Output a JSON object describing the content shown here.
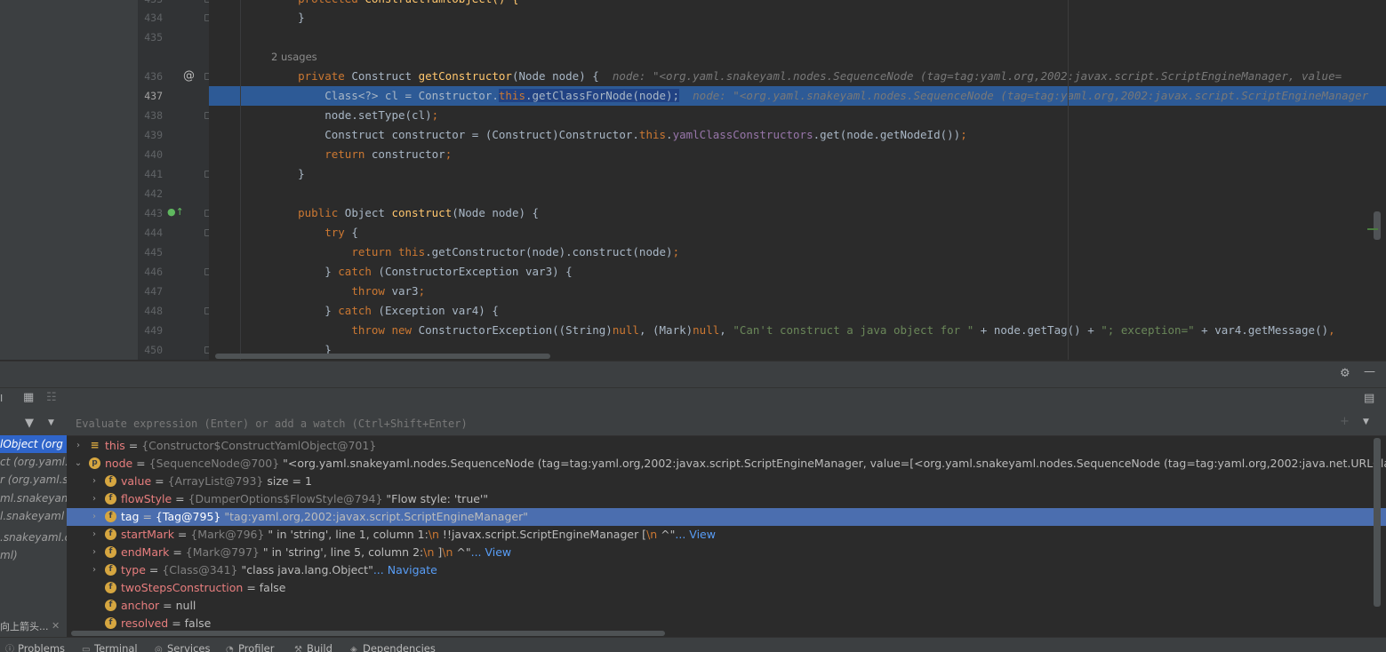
{
  "editor": {
    "usages_hint": "2 usages",
    "lines": [
      {
        "num": "433",
        "segments": [
          {
            "t": "    protected ",
            "c": "kw"
          },
          {
            "t": "ConstructYamlObject() {",
            "c": "fn"
          }
        ]
      },
      {
        "num": "434",
        "segments": [
          {
            "t": "    }"
          }
        ]
      },
      {
        "num": "435",
        "segments": []
      },
      {
        "num": "436",
        "segments": [
          {
            "t": "    private ",
            "c": "kw"
          },
          {
            "t": "Construct "
          },
          {
            "t": "getConstructor",
            "c": "fn"
          },
          {
            "t": "(Node node) {  "
          },
          {
            "t": "node: \"<org.yaml.snakeyaml.nodes.SequenceNode (tag=tag:yaml.org,2002:javax.script.ScriptEngineManager, value=",
            "c": "hint"
          }
        ]
      },
      {
        "num": "437",
        "segments": [
          {
            "t": "        Class<?> cl = Constructor."
          },
          {
            "t": "this",
            "c": "kw sel"
          },
          {
            "t": ".getClassForNode(node);",
            "c": "sel"
          },
          {
            "t": "  "
          },
          {
            "t": "node: \"<org.yaml.snakeyaml.nodes.SequenceNode (tag=tag:yaml.org,2002:javax.script.ScriptEngineManager",
            "c": "hint"
          }
        ]
      },
      {
        "num": "438",
        "segments": [
          {
            "t": "        node.setType(cl)"
          },
          {
            "t": ";",
            "c": "kw"
          }
        ]
      },
      {
        "num": "439",
        "segments": [
          {
            "t": "        Construct constructor = (Construct)Constructor."
          },
          {
            "t": "this",
            "c": "kw"
          },
          {
            "t": "."
          },
          {
            "t": "yamlClassConstructors",
            "c": "fld"
          },
          {
            "t": ".get(node.getNodeId())"
          },
          {
            "t": ";",
            "c": "kw"
          }
        ]
      },
      {
        "num": "440",
        "segments": [
          {
            "t": "        "
          },
          {
            "t": "return ",
            "c": "kw"
          },
          {
            "t": "constructor"
          },
          {
            "t": ";",
            "c": "kw"
          }
        ]
      },
      {
        "num": "441",
        "segments": [
          {
            "t": "    }"
          }
        ]
      },
      {
        "num": "442",
        "segments": []
      },
      {
        "num": "443",
        "segments": [
          {
            "t": "    public ",
            "c": "kw"
          },
          {
            "t": "Object "
          },
          {
            "t": "construct",
            "c": "fn"
          },
          {
            "t": "(Node node) {"
          }
        ]
      },
      {
        "num": "444",
        "segments": [
          {
            "t": "        "
          },
          {
            "t": "try ",
            "c": "kw"
          },
          {
            "t": "{"
          }
        ]
      },
      {
        "num": "445",
        "segments": [
          {
            "t": "            "
          },
          {
            "t": "return this",
            "c": "kw"
          },
          {
            "t": ".getConstructor(node).construct(node)"
          },
          {
            "t": ";",
            "c": "kw"
          }
        ]
      },
      {
        "num": "446",
        "segments": [
          {
            "t": "        } "
          },
          {
            "t": "catch ",
            "c": "kw"
          },
          {
            "t": "(ConstructorException var3) {"
          }
        ]
      },
      {
        "num": "447",
        "segments": [
          {
            "t": "            "
          },
          {
            "t": "throw ",
            "c": "kw"
          },
          {
            "t": "var3"
          },
          {
            "t": ";",
            "c": "kw"
          }
        ]
      },
      {
        "num": "448",
        "segments": [
          {
            "t": "        } "
          },
          {
            "t": "catch ",
            "c": "kw"
          },
          {
            "t": "(Exception var4) {"
          }
        ]
      },
      {
        "num": "449",
        "segments": [
          {
            "t": "            "
          },
          {
            "t": "throw new ",
            "c": "kw"
          },
          {
            "t": "ConstructorException((String)"
          },
          {
            "t": "null",
            "c": "kw"
          },
          {
            "t": ", (Mark)"
          },
          {
            "t": "null",
            "c": "kw"
          },
          {
            "t": ", "
          },
          {
            "t": "\"Can't construct a java object for \"",
            "c": "str"
          },
          {
            "t": " + node.getTag() + "
          },
          {
            "t": "\"; exception=\"",
            "c": "str"
          },
          {
            "t": " + var4.getMessage()"
          },
          {
            "t": ",",
            "c": "kw"
          }
        ]
      },
      {
        "num": "450",
        "segments": [
          {
            "t": "        }"
          }
        ]
      }
    ]
  },
  "debugger": {
    "watch_placeholder": "Evaluate expression (Enter) or add a watch (Ctrl+Shift+Enter)",
    "frames": [
      {
        "label": "lObject (org"
      },
      {
        "label": "ct (org.yaml."
      },
      {
        "label": "r (org.yaml.s"
      },
      {
        "label": "ml.snakeyaml."
      },
      {
        "label": "l.snakeyaml"
      },
      {
        "label": ".snakeyaml.c"
      },
      {
        "label": "ml)"
      }
    ],
    "frames_bottom_label": "向上箭头...",
    "variables": [
      {
        "name": "this",
        "badge": "list",
        "arrow": "›",
        "eq": " = ",
        "type": "{Constructor$ConstructYamlObject@701}",
        "rest": "",
        "link": ""
      },
      {
        "name": "node",
        "badge": "p",
        "arrow": "⌄",
        "eq": " = ",
        "type": "{SequenceNode@700} ",
        "rest": "\"<org.yaml.snakeyaml.nodes.SequenceNode (tag=tag:yaml.org,2002:javax.script.ScriptEngineManager, value=[<org.yaml.snakeyaml.nodes.SequenceNode (tag=tag:yaml.org,2002:java.net.URLClassLoader, valu",
        "link": "... View"
      },
      {
        "name": "value",
        "badge": "f",
        "arrow": "›",
        "eq": " = ",
        "type": "{ArrayList@793} ",
        "rest": " size = 1",
        "link": ""
      },
      {
        "name": "flowStyle",
        "badge": "f",
        "arrow": "›",
        "eq": " = ",
        "type": "{DumperOptions$FlowStyle@794} ",
        "rest": "\"Flow style: 'true'\"",
        "link": ""
      },
      {
        "name": "tag",
        "badge": "f",
        "arrow": "›",
        "eq": " = ",
        "type": "{Tag@795} ",
        "rest": "\"tag:yaml.org,2002:javax.script.ScriptEngineManager\"",
        "link": ""
      },
      {
        "name": "startMark",
        "badge": "f",
        "arrow": "›",
        "eq": " = ",
        "type": "{Mark@796} ",
        "rest": "\" in 'string', line 1, column 1:",
        "esc": "\\n",
        "rest2": "    !!javax.script.ScriptEngineManager [",
        "esc2": "\\n",
        "rest3": "    ^\"",
        "link": "... View"
      },
      {
        "name": "endMark",
        "badge": "f",
        "arrow": "›",
        "eq": " = ",
        "type": "{Mark@797} ",
        "rest": "\" in 'string', line 5, column 2:",
        "esc": "\\n",
        "rest2": "    ]",
        "esc2": "\\n",
        "rest3": "    ^\"",
        "link": "... View"
      },
      {
        "name": "type",
        "badge": "f",
        "arrow": "›",
        "eq": " = ",
        "type": "{Class@341} ",
        "rest": "\"class java.lang.Object\"",
        "link": "... Navigate"
      },
      {
        "name": "twoStepsConstruction",
        "badge": "f",
        "arrow": "",
        "eq": " = ",
        "type": "",
        "rest": "false",
        "link": ""
      },
      {
        "name": "anchor",
        "badge": "f",
        "arrow": "",
        "eq": " = ",
        "type": "",
        "rest": "null",
        "link": ""
      },
      {
        "name": "resolved",
        "badge": "f",
        "arrow": "",
        "eq": " = ",
        "type": "",
        "rest": "false",
        "link": ""
      }
    ]
  },
  "statusbar": {
    "tools": [
      {
        "label": "Problems",
        "icon": "problems-icon"
      },
      {
        "label": "Terminal",
        "icon": "terminal-icon"
      },
      {
        "label": "Services",
        "icon": "services-icon"
      },
      {
        "label": "Profiler",
        "icon": "profiler-icon"
      },
      {
        "label": "Build",
        "icon": "build-icon"
      },
      {
        "label": "Dependencies",
        "icon": "dependencies-icon"
      }
    ]
  },
  "colors": {
    "editor_bg": "#2b2b2b",
    "execution_line": "#2d5a96",
    "selected_variable": "#4b6eaf",
    "keyword": "#cc7832",
    "method": "#ffc66d",
    "string": "#6a8759",
    "field": "#9876aa"
  }
}
